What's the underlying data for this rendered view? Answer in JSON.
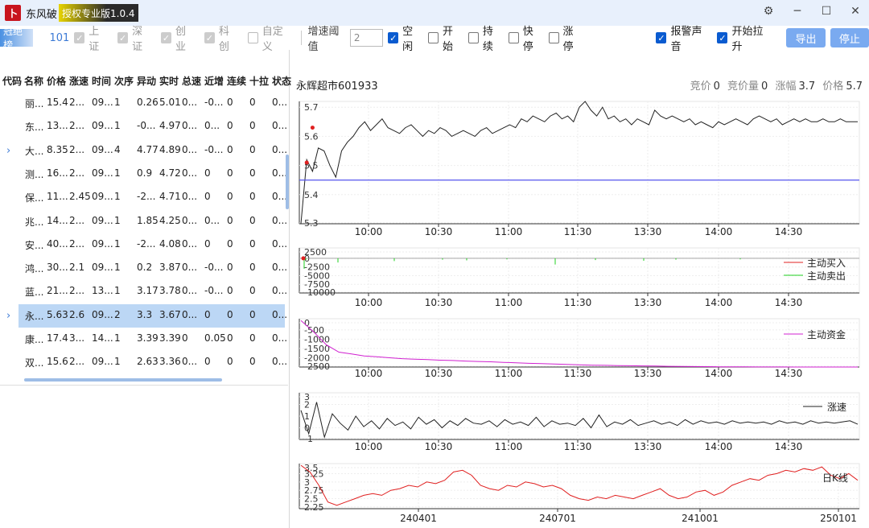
{
  "title": {
    "logo_glyph": "卜",
    "app_name": "东风破",
    "version": "授权专业版1.0.4"
  },
  "window_controls": [
    "⚙",
    "─",
    "☐",
    "✕"
  ],
  "toolbar": {
    "tag": "冠绝榜",
    "count": "101",
    "markets": [
      {
        "label": "上证",
        "checked": true,
        "disabled": true
      },
      {
        "label": "深证",
        "checked": true,
        "disabled": true
      },
      {
        "label": "创业",
        "checked": true,
        "disabled": true
      },
      {
        "label": "科创",
        "checked": true,
        "disabled": true
      },
      {
        "label": "自定义",
        "checked": false,
        "disabled": true
      }
    ],
    "threshold_label": "增速阈值",
    "threshold_value": "2",
    "filters": [
      {
        "label": "空闲",
        "checked": true
      },
      {
        "label": "开始",
        "checked": false
      },
      {
        "label": "持续",
        "checked": false
      },
      {
        "label": "快停",
        "checked": false
      },
      {
        "label": "涨停",
        "checked": false
      }
    ],
    "alarm_sound": "报警声音",
    "start_rise": "开始拉升",
    "export_label": "导出",
    "stop_label": "停止"
  },
  "table": {
    "headers": [
      "代码",
      "名称",
      "价格",
      "涨速",
      "时间",
      "次序",
      "异动",
      "实时",
      "总速",
      "近增",
      "连续",
      "十拉",
      "状态"
    ],
    "rows": [
      {
        "chev": "",
        "cells": [
          "丽...",
          "15.4",
          "2...",
          "09...",
          "1",
          "0.26",
          "5.01",
          "0...",
          "-0...",
          "0",
          "0",
          "0..."
        ]
      },
      {
        "chev": "",
        "cells": [
          "东...",
          "13...",
          "2...",
          "09...",
          "1",
          "-0...",
          "4.97",
          "0...",
          "0...",
          "0",
          "0",
          "0..."
        ]
      },
      {
        "chev": "›",
        "cells": [
          "大...",
          "8.35",
          "2...",
          "09...",
          "4",
          "4.77",
          "4.89",
          "0...",
          "-0...",
          "0",
          "0",
          "0..."
        ]
      },
      {
        "chev": "",
        "cells": [
          "测...",
          "16...",
          "2...",
          "09...",
          "1",
          "0.9",
          "4.72",
          "0...",
          "0",
          "0",
          "0",
          "0..."
        ]
      },
      {
        "chev": "",
        "cells": [
          "保...",
          "11...",
          "2.45",
          "09...",
          "1",
          "-2...",
          "4.71",
          "0...",
          "0",
          "0",
          "0",
          "0..."
        ]
      },
      {
        "chev": "",
        "cells": [
          "兆...",
          "14...",
          "2...",
          "09...",
          "1",
          "1.85",
          "4.25",
          "0...",
          "0...",
          "0",
          "0",
          "0..."
        ]
      },
      {
        "chev": "",
        "cells": [
          "安...",
          "40...",
          "2...",
          "09...",
          "1",
          "-2...",
          "4.08",
          "0...",
          "0",
          "0",
          "0",
          "0..."
        ]
      },
      {
        "chev": "",
        "cells": [
          "鸿...",
          "30...",
          "2.1",
          "09...",
          "1",
          "0.2",
          "3.87",
          "0...",
          "-0...",
          "0",
          "0",
          "0..."
        ]
      },
      {
        "chev": "",
        "cells": [
          "蓝...",
          "21...",
          "2...",
          "13...",
          "1",
          "3.17",
          "3.78",
          "0...",
          "-0...",
          "0",
          "0",
          "0..."
        ]
      },
      {
        "chev": "›",
        "selected": true,
        "cells": [
          "永...",
          "5.63",
          "2.6",
          "09...",
          "2",
          "3.3",
          "3.67",
          "0...",
          "0",
          "0",
          "0",
          "0..."
        ]
      },
      {
        "chev": "",
        "cells": [
          "康...",
          "17.4",
          "3...",
          "14...",
          "1",
          "3.39",
          "3.39",
          "0",
          "0.05",
          "0",
          "0",
          "0..."
        ]
      },
      {
        "chev": "",
        "cells": [
          "双...",
          "15.6",
          "2...",
          "09...",
          "1",
          "2.63",
          "3.36",
          "0...",
          "0",
          "0",
          "0",
          "0..."
        ]
      }
    ]
  },
  "stock": {
    "name": "永辉超市601933"
  },
  "quote": [
    {
      "label": "竞价",
      "value": "0"
    },
    {
      "label": "竞价量",
      "value": "0"
    },
    {
      "label": "涨幅",
      "value": "3.7"
    },
    {
      "label": "价格",
      "value": "5.7"
    }
  ],
  "colors": {
    "accent": "#0a5bd0",
    "selected_row": "#bcd7f5",
    "buy": "#e02020",
    "sell": "#20d020",
    "fund": "#d020d0",
    "price": "#222222",
    "baseline": "#5555ee",
    "daily": "#e02020"
  },
  "chart_data": [
    {
      "type": "line",
      "id": "intraday-price",
      "x_ticks": [
        "10:00",
        "10:30",
        "11:00",
        "11:30",
        "13:30",
        "14:00",
        "14:30"
      ],
      "y_ticks": [
        "5.3",
        "5.4",
        "5.5",
        "5.6",
        "5.7"
      ],
      "ylim": [
        5.3,
        5.72
      ],
      "baseline": 5.45,
      "series": [
        {
          "values": [
            5.3,
            5.52,
            5.48,
            5.56,
            5.55,
            5.5,
            5.46,
            5.55,
            5.58,
            5.6,
            5.63,
            5.65,
            5.62,
            5.64,
            5.66,
            5.63,
            5.62,
            5.61,
            5.63,
            5.64,
            5.62,
            5.6,
            5.62,
            5.61,
            5.63,
            5.62,
            5.6,
            5.61,
            5.62,
            5.61,
            5.6,
            5.62,
            5.63,
            5.61,
            5.62,
            5.63,
            5.64,
            5.63,
            5.66,
            5.65,
            5.67,
            5.66,
            5.65,
            5.67,
            5.68,
            5.66,
            5.67,
            5.65,
            5.7,
            5.72,
            5.69,
            5.67,
            5.7,
            5.66,
            5.67,
            5.65,
            5.66,
            5.64,
            5.66,
            5.65,
            5.64,
            5.69,
            5.67,
            5.66,
            5.67,
            5.66,
            5.65,
            5.66,
            5.64,
            5.65,
            5.64,
            5.63,
            5.65,
            5.64,
            5.65,
            5.66,
            5.65,
            5.64,
            5.66,
            5.67,
            5.66,
            5.65,
            5.66,
            5.64,
            5.65,
            5.66,
            5.65,
            5.66,
            5.65,
            5.65,
            5.66,
            5.65,
            5.65,
            5.66,
            5.65,
            5.65,
            5.65
          ]
        }
      ],
      "markers": [
        {
          "i": 1,
          "v": 5.51
        },
        {
          "i": 2,
          "v": 5.63
        }
      ]
    },
    {
      "type": "bar",
      "id": "active-flow",
      "x_ticks": [
        "10:00",
        "10:30",
        "11:00",
        "11:30",
        "13:30",
        "14:00",
        "14:30"
      ],
      "y_ticks": [
        "2500",
        "0",
        "-2500",
        "-5000",
        "-7500",
        "-10000"
      ],
      "ylim": [
        -10000,
        3000
      ],
      "legend": [
        "主动买入",
        "主动卖出"
      ],
      "buy_spikes": [],
      "sell_spikes": [
        -3000,
        -500,
        -1200,
        -800,
        -400,
        -600,
        -300,
        -1800,
        -500,
        -700,
        -400,
        -300
      ]
    },
    {
      "type": "line",
      "id": "active-fund",
      "x_ticks": [
        "10:00",
        "10:30",
        "11:00",
        "11:30",
        "13:30",
        "14:00",
        "14:30"
      ],
      "y_ticks": [
        "0",
        "-500",
        "-1000",
        "-1500",
        "-2000",
        "-2500"
      ],
      "ylim": [
        -2500,
        100
      ],
      "legend": [
        "主动资金"
      ],
      "series": [
        {
          "values": [
            0,
            -600,
            -1300,
            -1700,
            -1800,
            -1900,
            -1950,
            -2000,
            -2050,
            -2080,
            -2100,
            -2130,
            -2150,
            -2180,
            -2200,
            -2220,
            -2250,
            -2270,
            -2300,
            -2320,
            -2340,
            -2360,
            -2380,
            -2400,
            -2410,
            -2420,
            -2430,
            -2440,
            -2450,
            -2460,
            -2470,
            -2475,
            -2480,
            -2485,
            -2490,
            -2492,
            -2495,
            -2496,
            -2497,
            -2498,
            -2499,
            -2500,
            -2500,
            -2500,
            -2500
          ]
        }
      ]
    },
    {
      "type": "line",
      "id": "rise-speed",
      "x_ticks": [
        "10:00",
        "10:30",
        "11:00",
        "11:30",
        "13:30",
        "14:00",
        "14:30"
      ],
      "y_ticks": [
        "3",
        "2",
        "1",
        "0",
        "-1"
      ],
      "ylim": [
        -1,
        3
      ],
      "legend": [
        "涨速"
      ],
      "series": [
        {
          "values": [
            1.5,
            -0.5,
            2.2,
            -0.8,
            1.2,
            0.4,
            -0.2,
            1.0,
            0.1,
            0.6,
            -0.1,
            0.8,
            0.2,
            0.5,
            -0.1,
            0.9,
            0.3,
            0.7,
            0.0,
            0.6,
            0.2,
            0.8,
            0.4,
            0.3,
            0.6,
            0.1,
            0.7,
            0.3,
            0.5,
            0.2,
            0.9,
            0.1,
            0.6,
            0.3,
            0.4,
            0.2,
            0.8,
            0.0,
            1.1,
            0.1,
            0.5,
            0.3,
            0.7,
            0.2,
            0.4,
            0.6,
            0.3,
            0.5,
            0.2,
            0.7,
            0.3,
            0.6,
            0.4,
            0.5,
            0.3,
            0.6,
            0.4,
            0.5,
            0.4,
            0.5,
            0.3,
            0.6,
            0.4,
            0.5,
            0.3,
            0.6,
            0.4,
            0.5,
            0.4,
            0.5,
            0.6,
            0.3
          ]
        }
      ]
    },
    {
      "type": "line",
      "id": "daily",
      "x_ticks": [
        "240401",
        "240701",
        "241001",
        "250101"
      ],
      "y_ticks": [
        "3.5",
        "3.25",
        "3",
        "2.75",
        "2.5",
        "2.25"
      ],
      "ylim": [
        2.2,
        3.55
      ],
      "legend": [
        "日K线"
      ],
      "series": [
        {
          "values": [
            3.5,
            3.3,
            2.9,
            2.4,
            2.3,
            2.4,
            2.5,
            2.6,
            2.65,
            2.6,
            2.75,
            2.8,
            2.9,
            2.85,
            3.0,
            2.95,
            3.05,
            3.3,
            3.35,
            3.2,
            2.9,
            2.8,
            2.75,
            2.9,
            2.85,
            3.0,
            2.95,
            2.85,
            2.9,
            2.8,
            2.6,
            2.5,
            2.45,
            2.55,
            2.5,
            2.6,
            2.55,
            2.5,
            2.6,
            2.7,
            2.8,
            2.6,
            2.5,
            2.55,
            2.7,
            2.75,
            2.6,
            2.7,
            2.9,
            3.0,
            3.1,
            3.05,
            3.2,
            3.25,
            3.35,
            3.3,
            3.4,
            3.35,
            3.45,
            3.2,
            3.1,
            3.25,
            3.05
          ]
        }
      ]
    }
  ]
}
